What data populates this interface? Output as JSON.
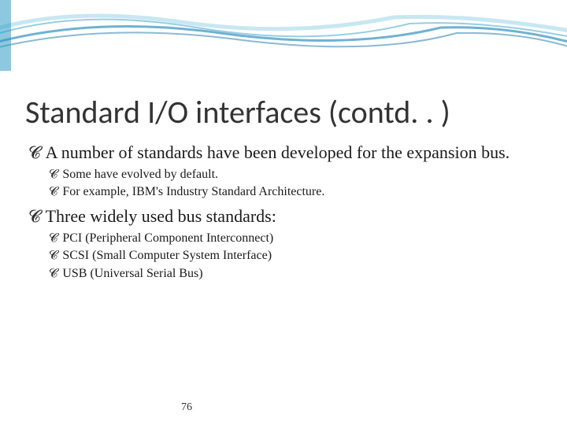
{
  "title": "Standard I/O interfaces (contd. . )",
  "bullets": {
    "main1": "A number of standards have been developed for the expansion bus.",
    "sub1a": "Some have evolved by default.",
    "sub1b": "For example, IBM's Industry Standard Architecture.",
    "main2": "Three widely used bus standards:",
    "sub2a": "PCI (Peripheral Component Interconnect)",
    "sub2b": "SCSI (Small Computer System Interface)",
    "sub2c": "USB (Universal Serial Bus)"
  },
  "pageNumber": "76",
  "bulletGlyph": "̑͜"
}
